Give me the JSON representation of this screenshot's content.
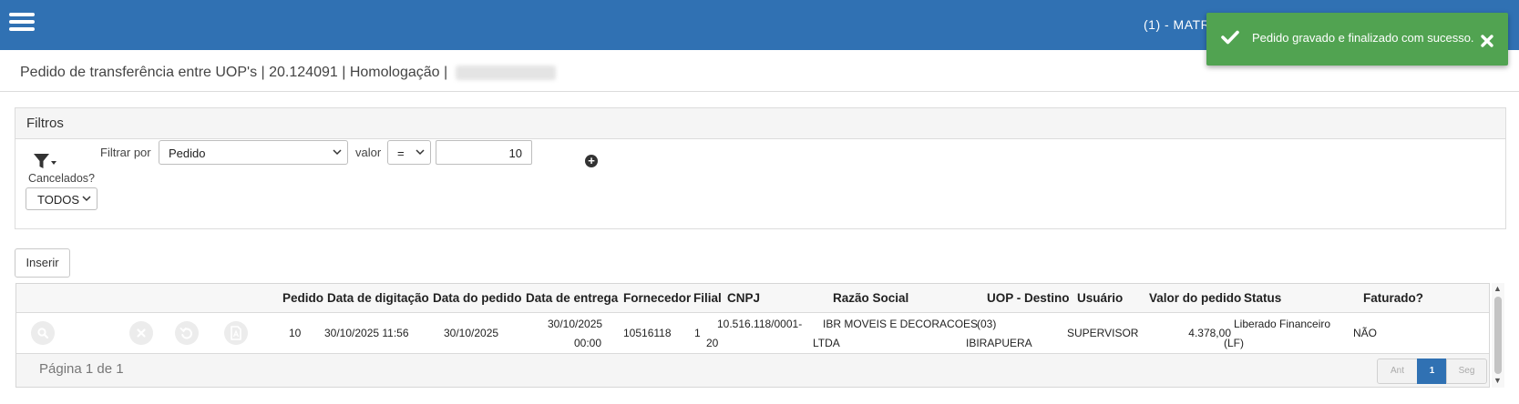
{
  "topbar": {
    "user_text": "(1) - MATR",
    "color": "#3071b3"
  },
  "toast": {
    "message": "Pedido gravado e finalizado com sucesso.",
    "color": "#51a351"
  },
  "page": {
    "title": "Pedido de transferência entre UOP's | 20.124091 | Homologação |"
  },
  "filters": {
    "title": "Filtros",
    "filter_by_label": "Filtrar por",
    "filter_by_value": "Pedido",
    "value_label": "valor",
    "operator": "=",
    "value": "10",
    "cancelled_label": "Cancelados?",
    "cancelled_value": "TODOS"
  },
  "actions": {
    "insert_label": "Inserir"
  },
  "table": {
    "columns": [
      "Pedido",
      "Data de digitação",
      "Data do pedido",
      "Data de entrega",
      "Fornecedor",
      "Filial",
      "CNPJ",
      "Razão Social",
      "UOP - Destino",
      "Usuário",
      "Valor do pedido",
      "Status",
      "Faturado?"
    ],
    "rows": [
      {
        "pedido": "10",
        "data_digitacao": "30/10/2025 11:56",
        "data_pedido": "30/10/2025",
        "data_entrega_1": "30/10/2025",
        "data_entrega_2": "00:00",
        "fornecedor": "10516118",
        "filial": "1",
        "cnpj_1": "10.516.118/0001-",
        "cnpj_2": "20",
        "razao_1": "IBR MOVEIS E DECORACOES",
        "razao_2": "LTDA",
        "uop_1": "(03)",
        "uop_2": "IBIRAPUERA",
        "usuario": "SUPERVISOR",
        "valor": "4.378,00",
        "status_1": "Liberado Financeiro",
        "status_2": "(LF)",
        "faturado": "NÃO"
      }
    ],
    "page_info": "Página 1 de 1",
    "pager": {
      "prev": "Ant",
      "current": "1",
      "next": "Seg"
    }
  }
}
